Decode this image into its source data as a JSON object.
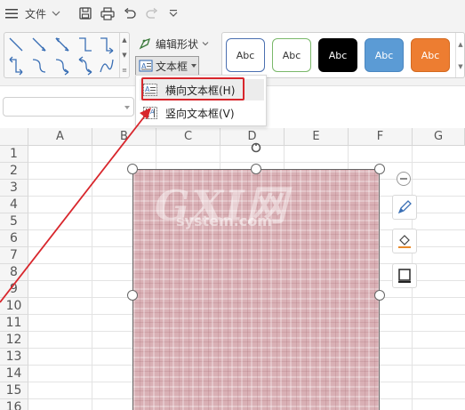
{
  "menubar": {
    "file_label": "文件",
    "file_icon": "hamburger-icon"
  },
  "ribbon": {
    "edit_shape_label": "编辑形状",
    "textbox_label": "文本框",
    "style_presets": [
      {
        "label": "Abc",
        "bg": "#ffffff",
        "fg": "#333333",
        "border": "#4a6fb0"
      },
      {
        "label": "Abc",
        "bg": "#ffffff",
        "fg": "#333333",
        "border": "#7ab86a"
      },
      {
        "label": "Abc",
        "bg": "#000000",
        "fg": "#ffffff",
        "border": "#000000"
      },
      {
        "label": "Abc",
        "bg": "#5b9bd5",
        "fg": "#ffffff",
        "border": "#4a86c0"
      },
      {
        "label": "Abc",
        "bg": "#ed7d31",
        "fg": "#ffffff",
        "border": "#d46a20"
      }
    ]
  },
  "textbox_menu": {
    "items": [
      {
        "label": "横向文本框(H)",
        "icon": "horizontal-textbox-icon",
        "highlighted": true
      },
      {
        "label": "竖向文本框(V)",
        "icon": "vertical-textbox-icon",
        "highlighted": false
      }
    ]
  },
  "sheet": {
    "columns": [
      "A",
      "B",
      "C",
      "D",
      "E",
      "F",
      "G"
    ],
    "rows": [
      "1",
      "2",
      "3",
      "4",
      "5",
      "6",
      "7",
      "8",
      "9",
      "10",
      "11",
      "12",
      "13",
      "14",
      "15",
      "16"
    ]
  },
  "watermark": {
    "logo": "GXI网",
    "site": "system.com"
  },
  "side_toolbar": {
    "icons": [
      "collapse-icon",
      "pen-style-icon",
      "fill-icon",
      "outline-icon"
    ]
  },
  "colors": {
    "accent_red": "#d8262c",
    "shape_fill": "#d9b0b5",
    "ribbon_bg": "#f3f3f3"
  }
}
